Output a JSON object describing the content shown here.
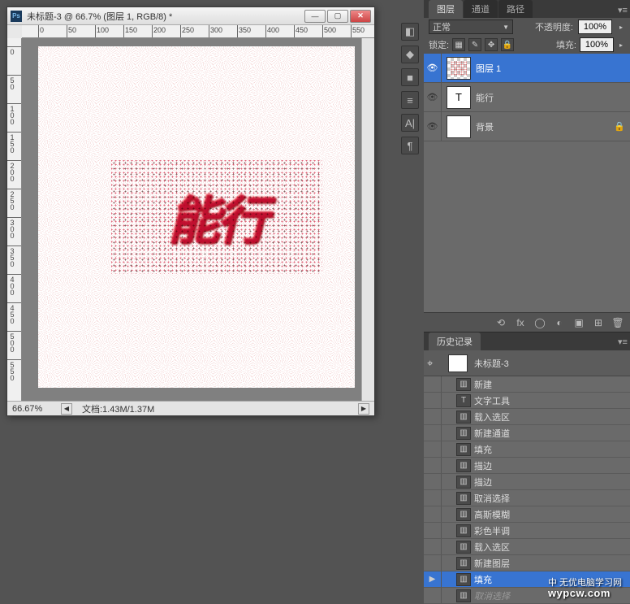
{
  "document": {
    "title": "未标题-3 @ 66.7% (图层 1, RGB/8) *",
    "zoom": "66.67%",
    "doc_size": "文档:1.43M/1.37M",
    "art_text": "能行"
  },
  "ruler_h": [
    0,
    50,
    100,
    150,
    200,
    250,
    300,
    350,
    400,
    450,
    500,
    550
  ],
  "ruler_v": [
    0,
    50,
    100,
    150,
    200,
    250,
    300,
    350,
    400,
    450,
    500,
    550
  ],
  "side_icons": [
    "◧",
    "◆",
    "■",
    "≡",
    "A|",
    "¶"
  ],
  "tabs": {
    "layers": "图层",
    "channels": "通道",
    "paths": "路径"
  },
  "layers_panel": {
    "blend_mode": "正常",
    "opacity_label": "不透明度:",
    "opacity_value": "100%",
    "lock_label": "锁定:",
    "fill_label": "填充:",
    "fill_value": "100%",
    "layers": [
      {
        "name": "图层 1",
        "type": "checker",
        "selected": true,
        "locked": false
      },
      {
        "name": "能行",
        "type": "text",
        "selected": false,
        "locked": false
      },
      {
        "name": "背景",
        "type": "white",
        "selected": false,
        "locked": true
      }
    ],
    "footer_icons": [
      "⟲",
      "fx",
      "◯",
      "◐",
      "▣",
      "⊞",
      "🗑"
    ]
  },
  "history_panel": {
    "title": "历史记录",
    "snapshot": "未标题-3",
    "steps": [
      {
        "name": "新建",
        "icon": "▥",
        "current": false,
        "past": true
      },
      {
        "name": "文字工具",
        "icon": "T",
        "current": false,
        "past": true
      },
      {
        "name": "载入选区",
        "icon": "▥",
        "current": false,
        "past": true
      },
      {
        "name": "新建通道",
        "icon": "▥",
        "current": false,
        "past": true
      },
      {
        "name": "填充",
        "icon": "▥",
        "current": false,
        "past": true
      },
      {
        "name": "描边",
        "icon": "▥",
        "current": false,
        "past": true
      },
      {
        "name": "描边",
        "icon": "▥",
        "current": false,
        "past": true
      },
      {
        "name": "取消选择",
        "icon": "▥",
        "current": false,
        "past": true
      },
      {
        "name": "高斯模糊",
        "icon": "▥",
        "current": false,
        "past": true
      },
      {
        "name": "彩色半调",
        "icon": "▥",
        "current": false,
        "past": true
      },
      {
        "name": "载入选区",
        "icon": "▥",
        "current": false,
        "past": true
      },
      {
        "name": "新建图层",
        "icon": "▥",
        "current": false,
        "past": true
      },
      {
        "name": "填充",
        "icon": "▥",
        "current": true,
        "past": true
      },
      {
        "name": "取消选择",
        "icon": "▥",
        "current": false,
        "past": false
      }
    ]
  },
  "watermark": {
    "line1": "中 无优电脑学习网",
    "url": "wypcw.com"
  }
}
